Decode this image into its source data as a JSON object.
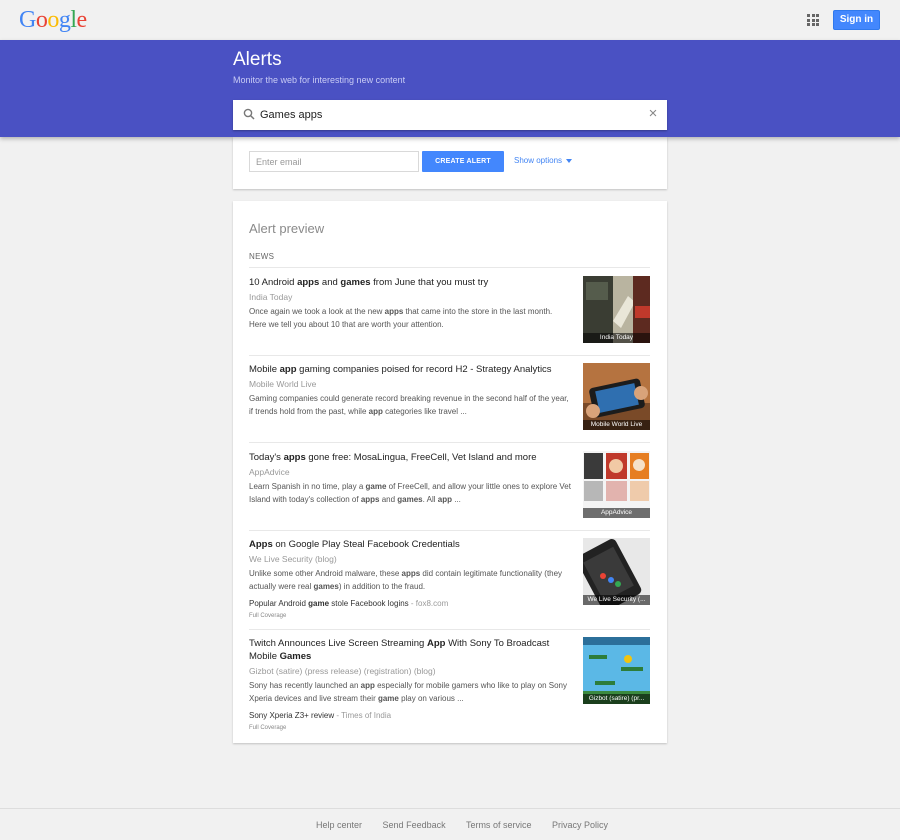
{
  "header": {
    "logo": [
      "G",
      "o",
      "o",
      "g",
      "l",
      "e"
    ],
    "logo_colors": [
      "#4285f4",
      "#ea4335",
      "#fbbc05",
      "#4285f4",
      "#34a853",
      "#ea4335"
    ],
    "apps_icon": "apps-grid-icon",
    "sign_in": "Sign in"
  },
  "banner": {
    "title": "Alerts",
    "subtitle": "Monitor the web for interesting new content",
    "search_value": "Games apps",
    "clear_icon": "×"
  },
  "create": {
    "email_placeholder": "Enter email",
    "button": "CREATE ALERT",
    "show_options": "Show options"
  },
  "preview": {
    "heading": "Alert preview",
    "section": "NEWS",
    "articles": [
      {
        "title_html": "10 Android <b>apps</b> and <b>games</b> from June that you must try",
        "source": "India Today",
        "snippet_html": "Once again we took a look at the new <b>apps</b> that came into the store in the last month. Here we tell you about 10 that are worth your attention.",
        "thumb_caption": "India Today"
      },
      {
        "title_html": "Mobile <b>app</b> gaming companies poised for record H2 - Strategy Analytics",
        "source": "Mobile World Live",
        "snippet_html": "Gaming companies could generate record breaking revenue in the second half of the year, if trends hold from the past, while <b>app</b> categories like travel ...",
        "thumb_caption": "Mobile World Live"
      },
      {
        "title_html": "Today's <b>apps</b> gone free: MosaLingua, FreeCell, Vet Island and more",
        "source": "AppAdvice",
        "snippet_html": "Learn Spanish in no time, play a <b>game</b> of FreeCell, and allow your little ones to explore Vet Island with today's collection of <b>apps</b> and <b>games</b>. All <b>app</b> ...",
        "thumb_caption": "AppAdvice"
      },
      {
        "title_html": "<b>Apps</b> on Google Play Steal Facebook Credentials",
        "source": "We Live Security (blog)",
        "snippet_html": "Unlike some other Android malware, these <b>apps</b> did contain legitimate functionality (they actually were real <b>games</b>) in addition to the fraud.",
        "related_html": "Popular Android <b>game</b> stole Facebook logins",
        "related_source": " - fox8.com",
        "full_coverage": "Full Coverage",
        "thumb_caption": "We Live Security (..."
      },
      {
        "title_html": "Twitch Announces Live Screen Streaming <b>App</b> With Sony To Broadcast Mobile <b>Games</b>",
        "source": "Gizbot (satire) (press release) (registration) (blog)",
        "snippet_html": "Sony has recently launched an <b>app</b> especially for mobile gamers who like to play on Sony Xperia devices and live stream their <b>game</b> play on various ...",
        "related_html": "Sony Xperia Z3+ review",
        "related_source": " - Times of India",
        "full_coverage": "Full Coverage",
        "thumb_caption": "Gizbot (satire) (pr..."
      }
    ]
  },
  "footer": {
    "links": [
      "Help center",
      "Send Feedback",
      "Terms of service",
      "Privacy Policy"
    ]
  }
}
